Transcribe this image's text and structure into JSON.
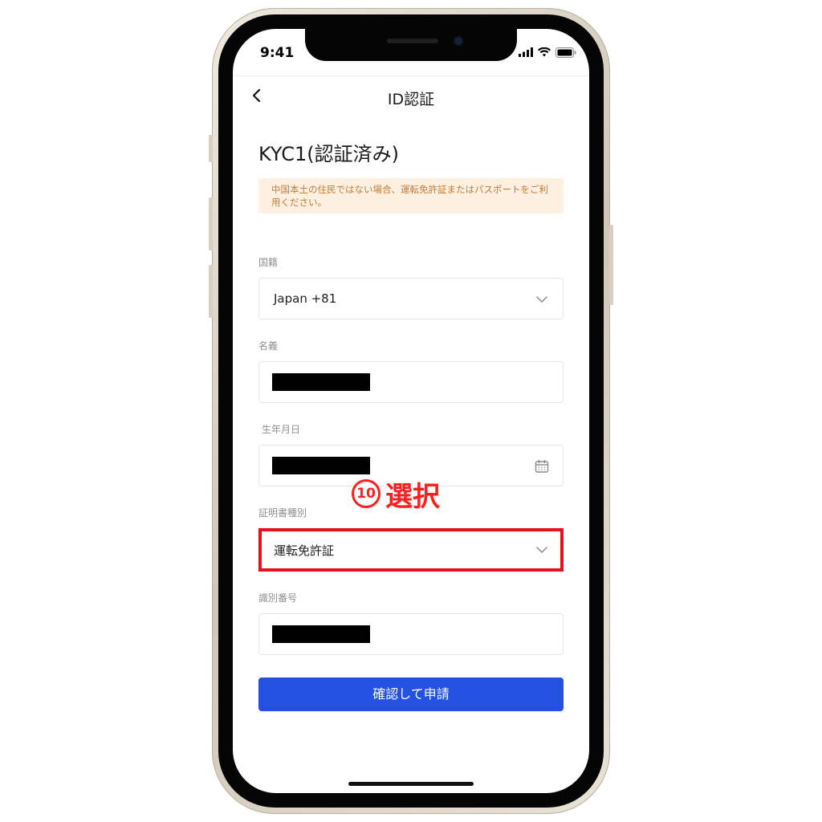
{
  "status_bar": {
    "time": "9:41"
  },
  "nav": {
    "title": "ID認証"
  },
  "page": {
    "title": "KYC1(認証済み)"
  },
  "notice": {
    "text": "中国本土の住民ではない場合、運転免許証またはパスポートをご利用ください。"
  },
  "form": {
    "nationality": {
      "label": "国籍",
      "value": "Japan +81"
    },
    "name": {
      "label": "名義",
      "value": ""
    },
    "birthdate": {
      "label": "生年月日",
      "value": ""
    },
    "document_type": {
      "label": "証明書種別",
      "value": "運転免許証"
    },
    "id_number": {
      "label": "識別番号",
      "value": ""
    }
  },
  "annotation": {
    "step_number": "10",
    "text": "選択"
  },
  "submit": {
    "label": "確認して申請"
  },
  "colors": {
    "accent": "#2352e0",
    "highlight": "#e8101c",
    "notice_bg": "#fdf0e1",
    "notice_text": "#c47a35"
  },
  "icons": [
    "back-arrow-icon",
    "chevron-down-icon",
    "calendar-icon",
    "signal-icon",
    "wifi-icon",
    "battery-icon"
  ]
}
